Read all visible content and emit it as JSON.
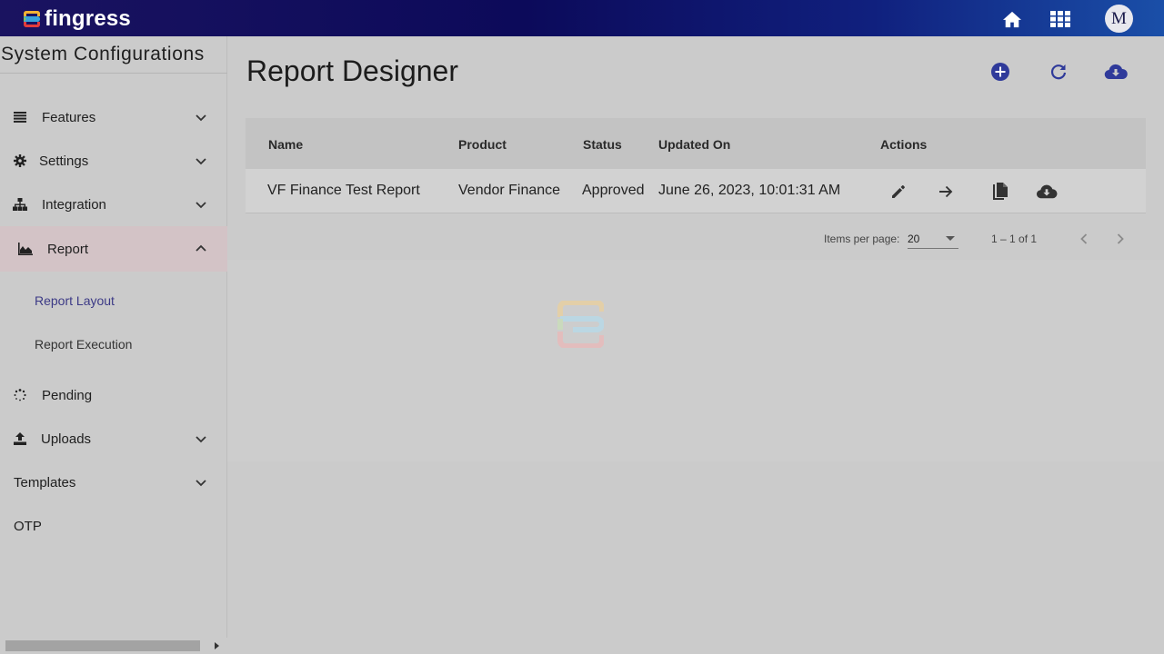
{
  "app": {
    "brand": "fingress",
    "avatar_initial": "M"
  },
  "sidebar": {
    "title": "System Configurations",
    "items": [
      {
        "label": "Features",
        "icon": "list-icon",
        "expandable": true
      },
      {
        "label": "Settings",
        "icon": "gear-icon",
        "expandable": true
      },
      {
        "label": "Integration",
        "icon": "sitemap-icon",
        "expandable": true
      },
      {
        "label": "Report",
        "icon": "area-chart-icon",
        "expandable": true,
        "expanded": true
      },
      {
        "label": "Pending",
        "icon": "spinner-icon",
        "expandable": false
      },
      {
        "label": "Uploads",
        "icon": "upload-icon",
        "expandable": true
      },
      {
        "label": "Templates",
        "icon": "",
        "expandable": true
      },
      {
        "label": "OTP",
        "icon": "",
        "expandable": false
      }
    ],
    "report_children": [
      {
        "label": "Report Layout",
        "selected": true
      },
      {
        "label": "Report Execution",
        "selected": false
      }
    ]
  },
  "main": {
    "title": "Report Designer",
    "actions": [
      "add-circle-icon",
      "refresh-icon",
      "cloud-download-icon"
    ],
    "table": {
      "columns": [
        "Name",
        "Product",
        "Status",
        "Updated On",
        "Actions"
      ],
      "rows": [
        {
          "name": "VF Finance Test Report",
          "product": "Vendor Finance",
          "status": "Approved",
          "updated_on": "June 26, 2023, 10:01:31 AM",
          "actions": [
            "edit-icon",
            "arrow-right-icon",
            "copy-icon",
            "cloud-download-icon"
          ]
        }
      ]
    },
    "paginator": {
      "items_per_page_label": "Items per page:",
      "page_size": "20",
      "range": "1 – 1 of 1"
    }
  },
  "colors": {
    "topbar_start": "#1a1360",
    "topbar_end": "#1a4fa8",
    "accent": "#2f3a9a",
    "active_nav_bg": "#d3c3c6",
    "selected_sub": "#3c3a86"
  }
}
